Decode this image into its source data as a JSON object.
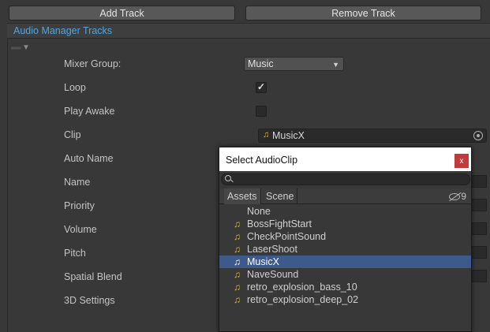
{
  "toolbar": {
    "add_label": "Add Track",
    "remove_label": "Remove Track"
  },
  "section": {
    "title": "Audio Manager Tracks"
  },
  "properties": {
    "mixer_group": {
      "label": "Mixer Group:",
      "value": "Music"
    },
    "loop": {
      "label": "Loop",
      "checked": true
    },
    "play_awake": {
      "label": "Play Awake",
      "checked": false
    },
    "clip": {
      "label": "Clip",
      "value": "MusicX"
    },
    "auto_name": {
      "label": "Auto Name"
    },
    "name": {
      "label": "Name"
    },
    "priority": {
      "label": "Priority"
    },
    "volume": {
      "label": "Volume"
    },
    "pitch": {
      "label": "Pitch"
    },
    "spatial_blend": {
      "label": "Spatial Blend"
    },
    "settings_3d": {
      "label": "3D Settings"
    }
  },
  "popup": {
    "title": "Select AudioClip",
    "close_label": "x",
    "search_value": "",
    "tabs": [
      "Assets",
      "Scene"
    ],
    "hidden_count": "9",
    "items": [
      "None",
      "BossFightStart",
      "CheckPointSound",
      "LaserShoot",
      "MusicX",
      "NaveSound",
      "retro_explosion_bass_10",
      "retro_explosion_deep_02"
    ],
    "selected": "MusicX"
  },
  "colors": {
    "accent": "#4fa6e0",
    "selection": "#3d5a8a",
    "audio_icon": "#e8b219",
    "close": "#c33a3a"
  },
  "icons": {
    "audio_clip": "music-note-icon",
    "object_picker": "object-picker-icon",
    "search": "search-icon",
    "visibility": "eye-slash-icon"
  }
}
